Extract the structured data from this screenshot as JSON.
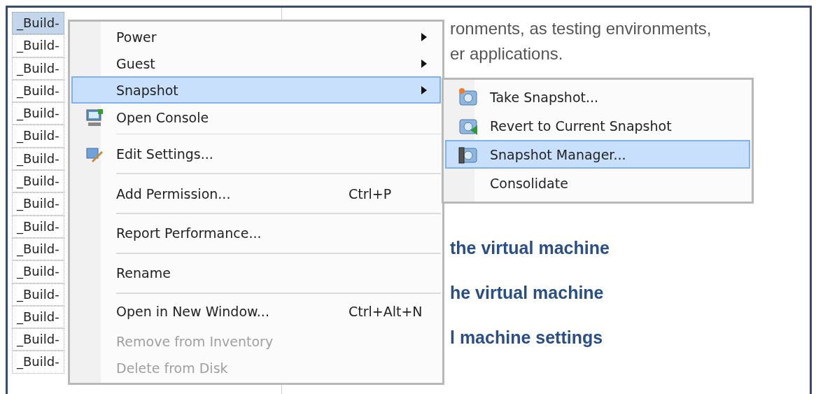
{
  "tree": {
    "items": [
      {
        "label": "_Build-",
        "selected": true
      },
      {
        "label": "_Build-",
        "selected": false
      },
      {
        "label": "_Build-",
        "selected": false
      },
      {
        "label": "_Build-",
        "selected": false
      },
      {
        "label": "_Build-",
        "selected": false
      },
      {
        "label": "_Build-",
        "selected": false
      },
      {
        "label": "_Build-",
        "selected": false
      },
      {
        "label": "_Build-",
        "selected": false
      },
      {
        "label": "_Build-",
        "selected": false
      },
      {
        "label": "_Build-",
        "selected": false
      },
      {
        "label": "_Build-",
        "selected": false
      },
      {
        "label": "_Build-",
        "selected": false
      },
      {
        "label": "_Build-",
        "selected": false
      },
      {
        "label": "_Build-",
        "selected": false
      },
      {
        "label": "_Build-",
        "selected": false
      },
      {
        "label": "_Build-",
        "selected": false
      }
    ]
  },
  "description": [
    "ronments, as testing environments,",
    "er applications."
  ],
  "tasks": [
    "the virtual machine",
    "he virtual machine",
    "l machine settings"
  ],
  "context_menu": {
    "items": [
      {
        "label": "Power",
        "submenu": true,
        "selected": false,
        "disabled": false,
        "separator_after": false
      },
      {
        "label": "Guest",
        "submenu": true,
        "selected": false,
        "disabled": false,
        "separator_after": false
      },
      {
        "label": "Snapshot",
        "submenu": true,
        "selected": true,
        "disabled": false,
        "separator_after": false
      },
      {
        "label": "Open Console",
        "submenu": false,
        "selected": false,
        "disabled": false,
        "separator_after": true
      },
      {
        "label": "Edit Settings...",
        "submenu": false,
        "selected": false,
        "disabled": false,
        "separator_after": true
      },
      {
        "label": "Add Permission...",
        "shortcut": "Ctrl+P",
        "submenu": false,
        "selected": false,
        "disabled": false,
        "separator_after": true
      },
      {
        "label": "Report Performance...",
        "submenu": false,
        "selected": false,
        "disabled": false,
        "separator_after": true
      },
      {
        "label": "Rename",
        "submenu": false,
        "selected": false,
        "disabled": false,
        "separator_after": true
      },
      {
        "label": "Open in New Window...",
        "shortcut": "Ctrl+Alt+N",
        "submenu": false,
        "selected": false,
        "disabled": false,
        "separator_after": false
      },
      {
        "label": "Remove from Inventory",
        "submenu": false,
        "selected": false,
        "disabled": true,
        "separator_after": false
      },
      {
        "label": "Delete from Disk",
        "submenu": false,
        "selected": false,
        "disabled": true,
        "separator_after": false
      }
    ]
  },
  "snapshot_submenu": {
    "items": [
      {
        "label": "Take Snapshot...",
        "selected": false
      },
      {
        "label": "Revert to Current Snapshot",
        "selected": false
      },
      {
        "label": "Snapshot Manager...",
        "selected": true
      },
      {
        "label": "Consolidate",
        "selected": false
      }
    ]
  }
}
